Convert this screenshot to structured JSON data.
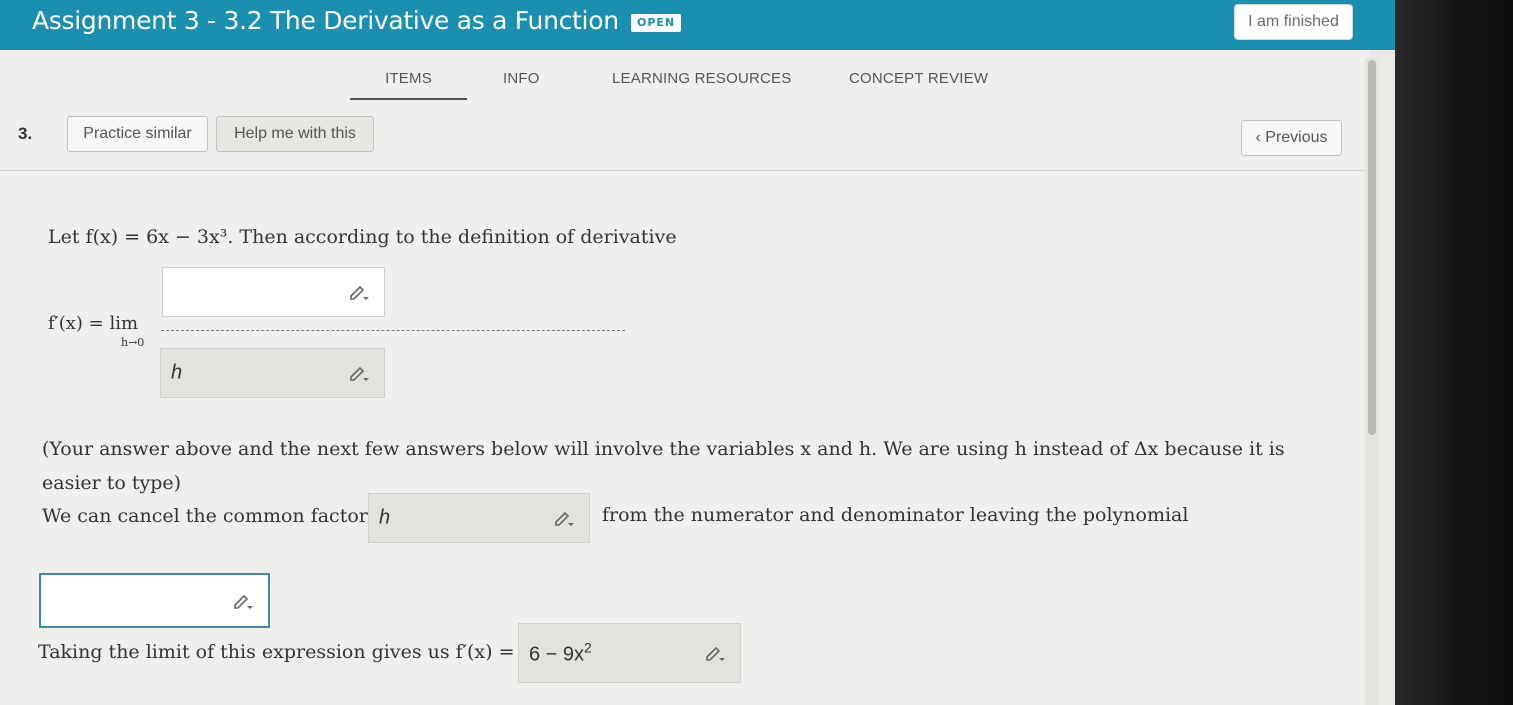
{
  "header": {
    "title": "Assignment 3 - 3.2 The Derivative as a Function",
    "status_badge": "OPEN",
    "finish_button": "I am finished"
  },
  "tabs": [
    {
      "label": "ITEMS",
      "active": true
    },
    {
      "label": "INFO",
      "active": false
    },
    {
      "label": "LEARNING RESOURCES",
      "active": false
    },
    {
      "label": "CONCEPT REVIEW",
      "active": false
    }
  ],
  "question": {
    "number": "3.",
    "practice_button": "Practice similar",
    "help_button": "Help me with this",
    "previous_button": "Previous",
    "intro": "Let f(x) = 6x − 3x³. Then according to the definition of derivative",
    "fprime_lim": "f′(x) = lim",
    "lim_subscript": "h→0",
    "numerator_value": "",
    "denominator_value": "h",
    "note": "(Your answer above and the next few answers below will involve the variables x and h. We are using h instead of Δx because it is easier to type)",
    "cancel_text_before": "We can cancel the common factor",
    "cancel_factor_value": "h",
    "cancel_text_after": "from the numerator and denominator leaving the polynomial",
    "polynomial_value": "",
    "limit_text": "Taking the limit of this expression gives us f′(x) =",
    "result_base": "6 − 9x",
    "result_exponent": "2"
  },
  "colors": {
    "header_bg": "#1a8fb0",
    "active_input_border": "#3d8da6"
  },
  "icons": [
    "chevron-left-icon",
    "pencil-dropdown-icon"
  ]
}
